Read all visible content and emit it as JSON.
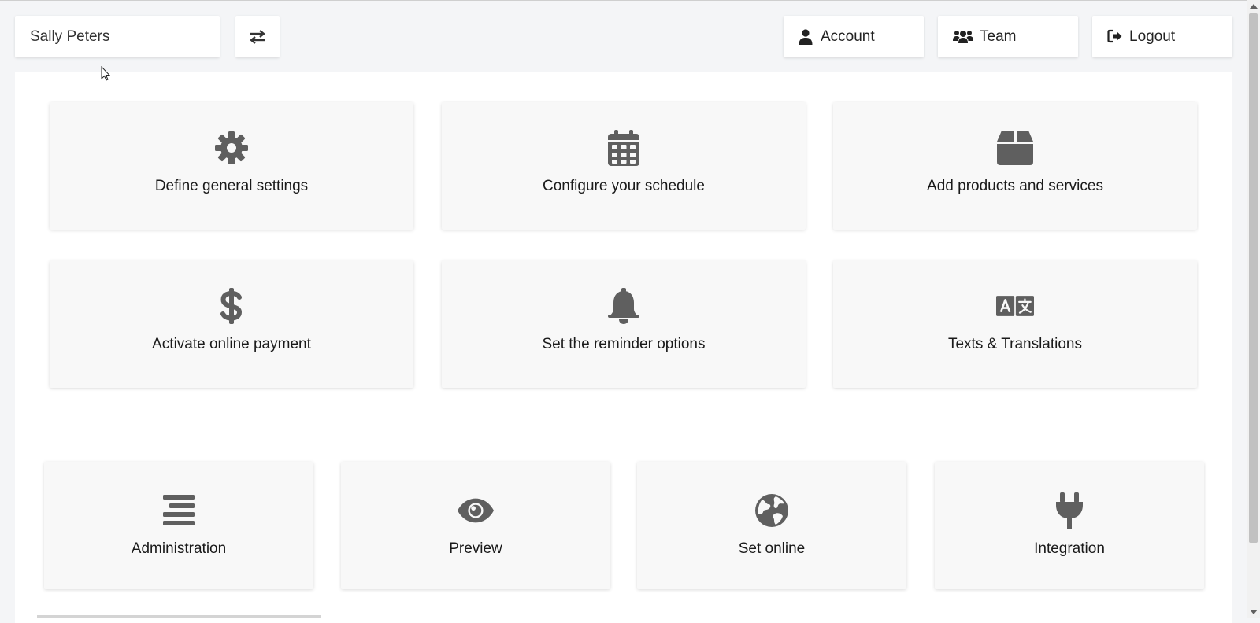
{
  "header": {
    "user_name": "Sally Peters",
    "switch_icon": "exchange-arrows-icon",
    "account_label": "Account",
    "team_label": "Team",
    "logout_label": "Logout"
  },
  "setup_cards": [
    {
      "label": "Define general settings",
      "icon": "gear-icon"
    },
    {
      "label": "Configure your schedule",
      "icon": "calendar-icon"
    },
    {
      "label": "Add products and services",
      "icon": "box-icon"
    },
    {
      "label": "Activate online payment",
      "icon": "dollar-icon"
    },
    {
      "label": "Set the reminder options",
      "icon": "bell-icon"
    },
    {
      "label": "Texts & Translations",
      "icon": "language-icon"
    }
  ],
  "action_cards": [
    {
      "label": "Administration",
      "icon": "align-center-icon"
    },
    {
      "label": "Preview",
      "icon": "eye-icon"
    },
    {
      "label": "Set online",
      "icon": "globe-icon"
    },
    {
      "label": "Integration",
      "icon": "plug-icon"
    }
  ],
  "colors": {
    "icon": "#5f5f5f",
    "card_bg": "#f8f8f8",
    "page_bg": "#f4f5f7"
  }
}
